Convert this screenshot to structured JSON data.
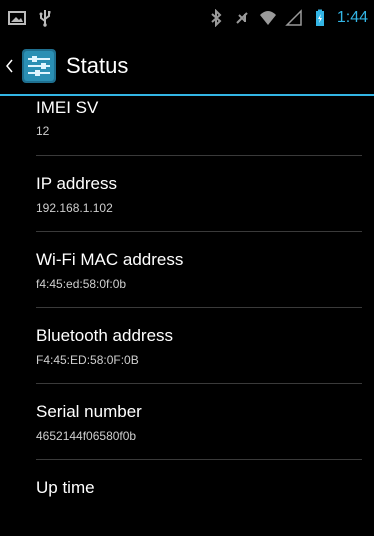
{
  "status_bar": {
    "time": "1:44",
    "left_icons": [
      "gallery-icon",
      "usb-icon"
    ],
    "right_icons": [
      "bluetooth-icon",
      "mute-icon",
      "wifi-icon",
      "signal-icon",
      "battery-icon"
    ]
  },
  "action_bar": {
    "title": "Status",
    "icon": "settings-app-icon",
    "accent_color": "#33b5e5"
  },
  "items": [
    {
      "label": "IMEI SV",
      "value": "12"
    },
    {
      "label": "IP address",
      "value": "192.168.1.102"
    },
    {
      "label": "Wi-Fi MAC address",
      "value": "f4:45:ed:58:0f:0b"
    },
    {
      "label": "Bluetooth address",
      "value": "F4:45:ED:58:0F:0B"
    },
    {
      "label": "Serial number",
      "value": "4652144f06580f0b"
    },
    {
      "label": "Up time",
      "value": ""
    }
  ]
}
